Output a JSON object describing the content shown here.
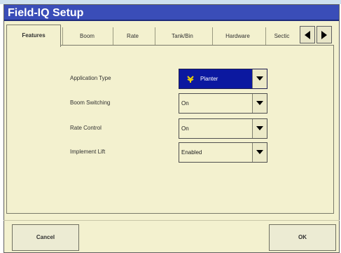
{
  "window": {
    "title": "Field-IQ Setup"
  },
  "tabs": [
    {
      "label": "Features",
      "active": true
    },
    {
      "label": "Boom"
    },
    {
      "label": "Rate"
    },
    {
      "label": "Tank/Bin"
    },
    {
      "label": "Hardware"
    },
    {
      "label": "Sectic"
    }
  ],
  "fields": {
    "application_type": {
      "label": "Application Type",
      "value": "Planter",
      "icon": "planter-icon"
    },
    "boom_switching": {
      "label": "Boom Switching",
      "value": "On"
    },
    "rate_control": {
      "label": "Rate Control",
      "value": "On"
    },
    "implement_lift": {
      "label": "Implement Lift",
      "value": "Enabled"
    }
  },
  "buttons": {
    "cancel": "Cancel",
    "ok": "OK"
  },
  "colors": {
    "titlebar": "#3a4db8",
    "panel_bg": "#f3f1cf",
    "selected_field": "#0b18a0",
    "planter_icon": "#f0d400"
  }
}
